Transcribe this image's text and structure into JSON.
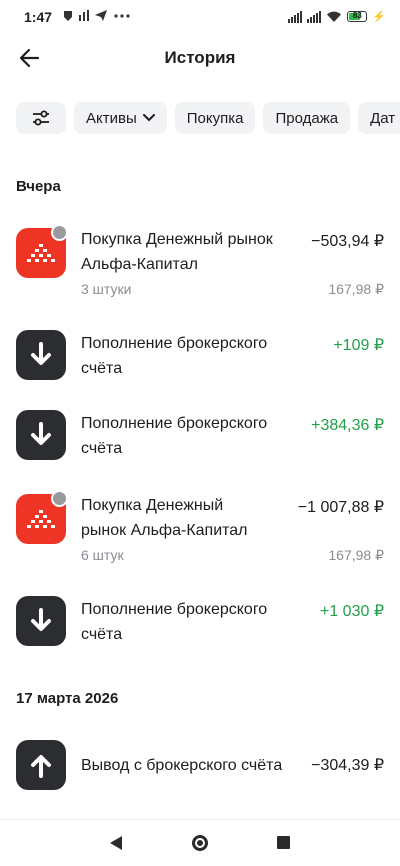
{
  "status": {
    "time": "1:47",
    "battery": "83"
  },
  "header": {
    "title": "История"
  },
  "filters": [
    "Активы",
    "Покупка",
    "Продажа",
    "Дат"
  ],
  "sections": {
    "yesterday": "Вчера",
    "date2": "17 марта 2026"
  },
  "items": [
    {
      "title": "Покупка Денежный рынок Альфа-Капитал",
      "sub": "3 штуки",
      "amount": "−503,94 ₽",
      "price": "167,98 ₽"
    },
    {
      "title": "Пополнение брокерского счёта",
      "amount": "+109 ₽"
    },
    {
      "title": "Пополнение брокерского счёта",
      "amount": "+384,36 ₽"
    },
    {
      "title": "Покупка Денежный рынок Альфа-Капитал",
      "sub": "6 штук",
      "amount": "−1 007,88 ₽",
      "price": "167,98 ₽"
    },
    {
      "title": "Пополнение брокерского счёта",
      "amount": "+1 030 ₽"
    },
    {
      "title": "Вывод с брокерского счёта",
      "amount": "−304,39 ₽"
    }
  ],
  "colors": {
    "accent_red": "#ee3424",
    "positive": "#22a04b",
    "icon_dark": "#2b2d31"
  }
}
